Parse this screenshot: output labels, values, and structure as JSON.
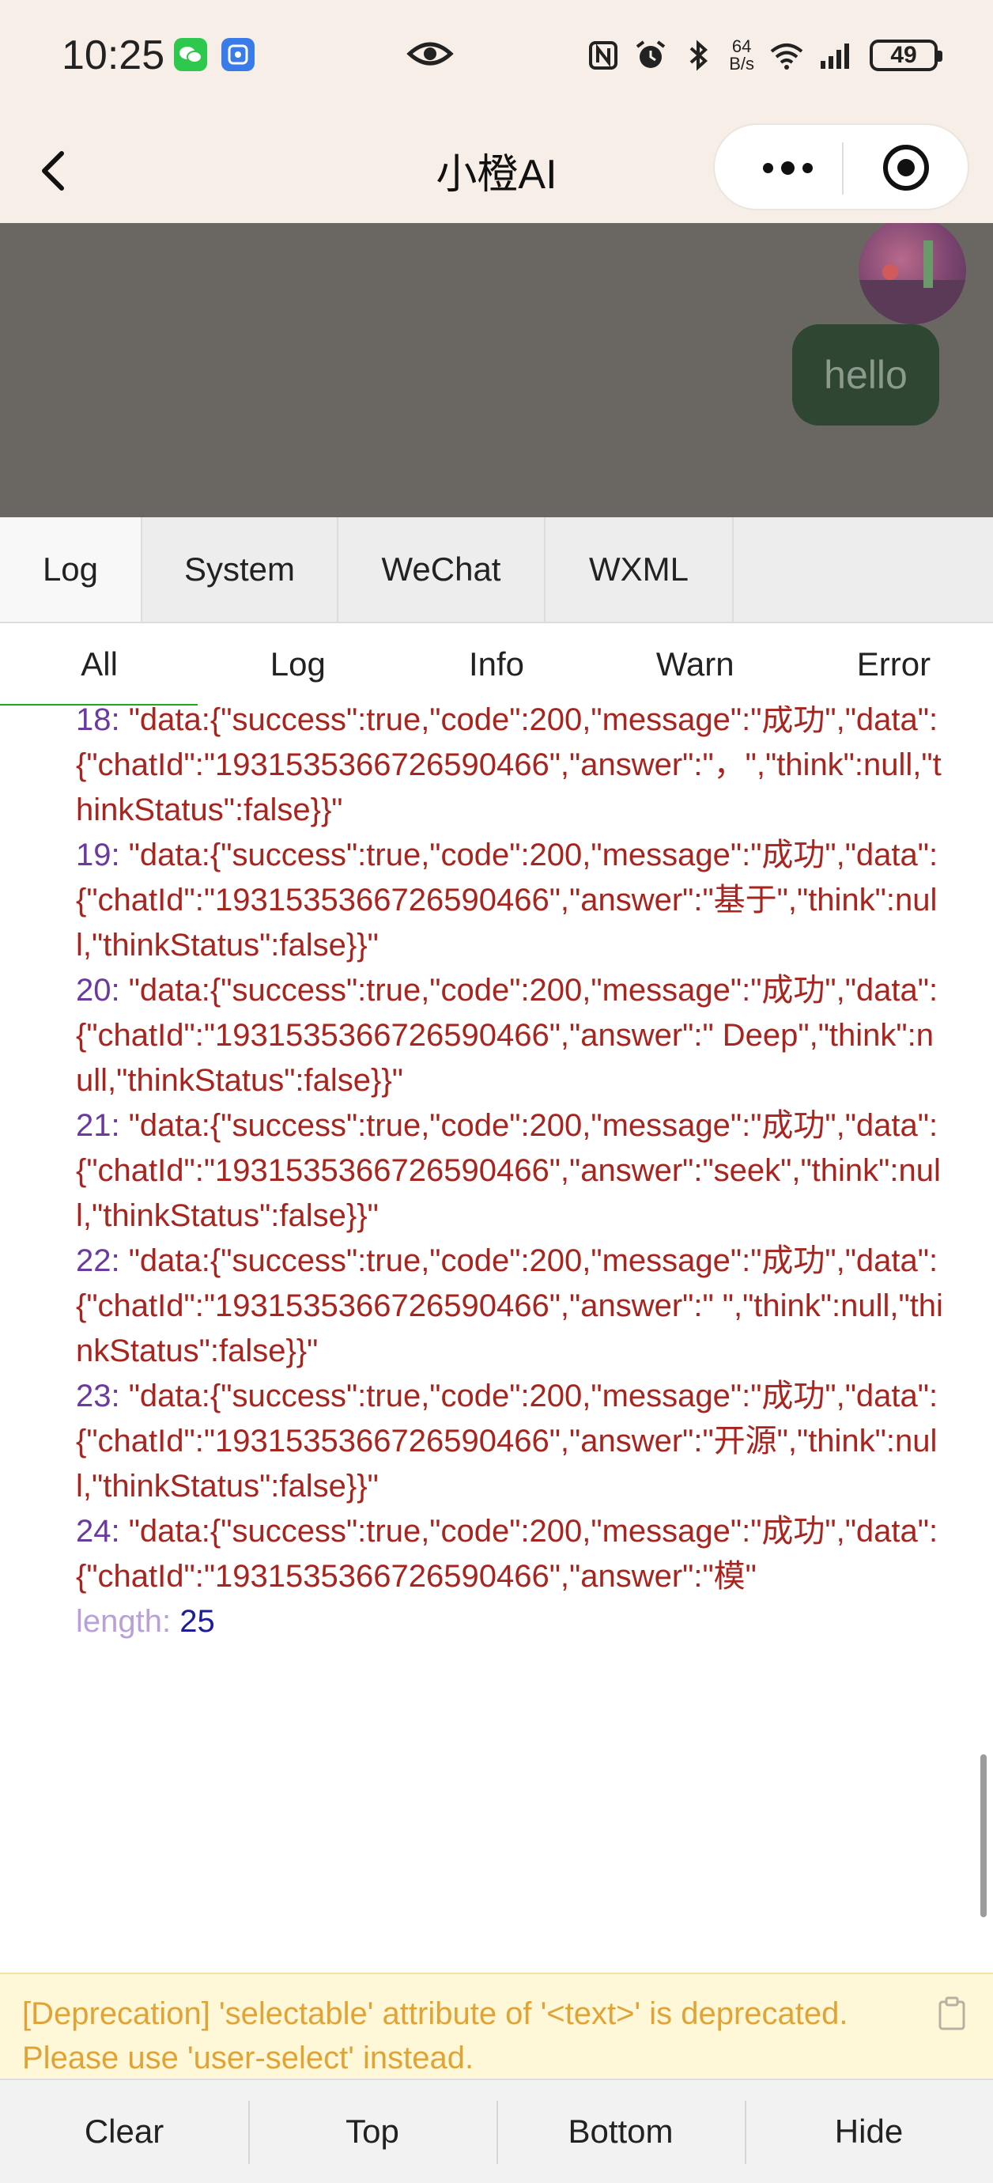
{
  "status_bar": {
    "time": "10:25",
    "net_speed_top": "64",
    "net_speed_bottom": "B/s",
    "battery": "49"
  },
  "nav": {
    "title": "小橙AI"
  },
  "chat": {
    "user_message": "hello"
  },
  "console": {
    "tabs": [
      "Log",
      "System",
      "WeChat",
      "WXML"
    ],
    "filters": [
      "All",
      "Log",
      "Info",
      "Warn",
      "Error"
    ],
    "log_entries": [
      {
        "index": "18",
        "text": "\"data:{\"success\":true,\"code\":200,\"message\":\"成功\",\"data\":{\"chatId\":\"1931535366726590466\",\"answer\":\"，\",\"think\":null,\"thinkStatus\":false}}\""
      },
      {
        "index": "19",
        "text": "\"data:{\"success\":true,\"code\":200,\"message\":\"成功\",\"data\":{\"chatId\":\"1931535366726590466\",\"answer\":\"基于\",\"think\":null,\"thinkStatus\":false}}\""
      },
      {
        "index": "20",
        "text": "\"data:{\"success\":true,\"code\":200,\"message\":\"成功\",\"data\":{\"chatId\":\"1931535366726590466\",\"answer\":\" Deep\",\"think\":null,\"thinkStatus\":false}}\""
      },
      {
        "index": "21",
        "text": "\"data:{\"success\":true,\"code\":200,\"message\":\"成功\",\"data\":{\"chatId\":\"1931535366726590466\",\"answer\":\"seek\",\"think\":null,\"thinkStatus\":false}}\""
      },
      {
        "index": "22",
        "text": "\"data:{\"success\":true,\"code\":200,\"message\":\"成功\",\"data\":{\"chatId\":\"1931535366726590466\",\"answer\":\" \",\"think\":null,\"thinkStatus\":false}}\""
      },
      {
        "index": "23",
        "text": "\"data:{\"success\":true,\"code\":200,\"message\":\"成功\",\"data\":{\"chatId\":\"1931535366726590466\",\"answer\":\"开源\",\"think\":null,\"thinkStatus\":false}}\""
      },
      {
        "index": "24",
        "text": "\"data:{\"success\":true,\"code\":200,\"message\":\"成功\",\"data\":{\"chatId\":\"1931535366726590466\",\"answer\":\"模\""
      }
    ],
    "length_key": "length",
    "length_value": "25",
    "warning": "[Deprecation] 'selectable' attribute of '<text>' is deprecated. Please use 'user-select' instead.",
    "toolbar": [
      "Clear",
      "Top",
      "Bottom",
      "Hide"
    ]
  }
}
